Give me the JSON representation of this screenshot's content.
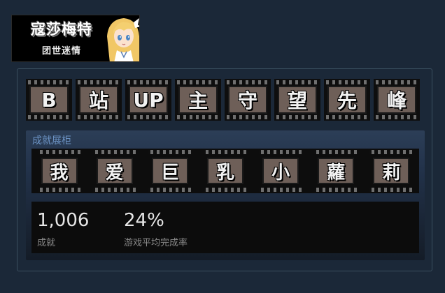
{
  "banner": {
    "title": "寇莎梅特",
    "subtitle": "团世迷情"
  },
  "title_letters": [
    "B",
    "站",
    "UP",
    "主",
    "守",
    "望",
    "先",
    "峰"
  ],
  "showcase": {
    "title": "成就展柜",
    "achievements": [
      "我",
      "爱",
      "巨",
      "乳",
      "小",
      "蘿",
      "莉"
    ],
    "stats": {
      "achievements_value": "1,006",
      "achievements_label": "成就",
      "completion_value": "24%",
      "completion_label": "游戏平均完成率"
    }
  },
  "colors": {
    "background": "#1b2838",
    "frame": "#6e5f58",
    "showcase_title": "#6c93c4"
  }
}
